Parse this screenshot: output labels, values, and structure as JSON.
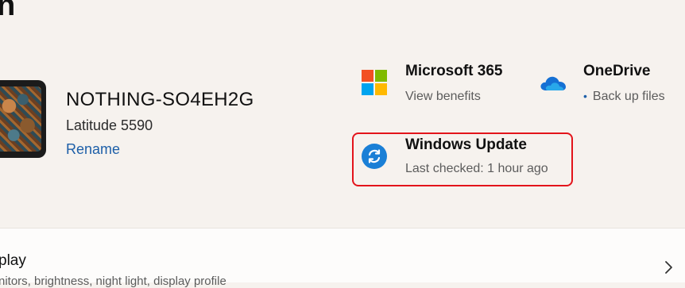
{
  "page": {
    "title": "n"
  },
  "device": {
    "name": "NOTHING-SO4EH2G",
    "model": "Latitude 5590",
    "rename_label": "Rename"
  },
  "cards": {
    "microsoft365": {
      "title": "Microsoft 365",
      "subtitle": "View benefits",
      "icon": "microsoft-logo-icon"
    },
    "onedrive": {
      "title": "OneDrive",
      "subtitle": "Back up files",
      "icon": "onedrive-cloud-icon"
    },
    "windows_update": {
      "title": "Windows Update",
      "subtitle": "Last checked: 1 hour ago",
      "icon": "sync-icon"
    }
  },
  "settings_list": {
    "display": {
      "title": "play",
      "description": "nitors, brightness, night light, display profile"
    }
  },
  "colors": {
    "accent": "#1d5fa8",
    "highlight_border": "#e3141b",
    "ms_red": "#f25022",
    "ms_green": "#7fba00",
    "ms_blue": "#00a4ef",
    "ms_yellow": "#ffb900",
    "update_blue": "#1a7fd6"
  }
}
